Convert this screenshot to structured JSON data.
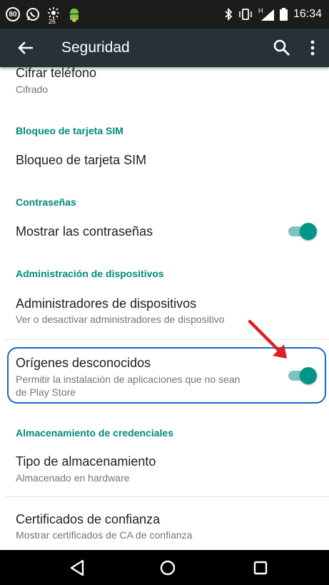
{
  "status_bar": {
    "badge": "80",
    "weather": "26",
    "signal_label": "H",
    "time": "16:34"
  },
  "app_bar": {
    "title": "Seguridad",
    "icons": [
      "back-arrow-icon",
      "search-icon",
      "more-vert-icon"
    ]
  },
  "settings": {
    "encrypt": {
      "title": "Cifrar teléfono",
      "summary": "Cifrado"
    },
    "sim_header": "Bloqueo de tarjeta SIM",
    "sim_lock": {
      "title": "Bloqueo de tarjeta SIM"
    },
    "passwords_header": "Contraseñas",
    "show_passwords": {
      "title": "Mostrar las contraseñas",
      "enabled": true
    },
    "device_admin_header": "Administración de dispositivos",
    "device_admins": {
      "title": "Administradores de dispositivos",
      "summary": "Ver o desactivar administradores de dispositivo"
    },
    "unknown_sources": {
      "title": "Orígenes desconocidos",
      "summary_line1": "Permitir la instalación de aplicaciones que no sean",
      "summary_line2": "de Play Store",
      "enabled": true
    },
    "credentials_header": "Almacenamiento de credenciales",
    "storage_type": {
      "title": "Tipo de almacenamiento",
      "summary": "Almacenado en hardware"
    },
    "trusted_certs": {
      "title": "Certificados de confianza",
      "summary": "Mostrar certificados de CA de confianza"
    }
  },
  "colors": {
    "accent": "#009688",
    "category_text": "#00897b",
    "app_bar": "#263238",
    "highlight_border": "#1a66c9",
    "annotation_arrow": "#e02020"
  },
  "nav_bar": {
    "icons": [
      "back-triangle-icon",
      "home-circle-icon",
      "recents-square-icon"
    ]
  }
}
